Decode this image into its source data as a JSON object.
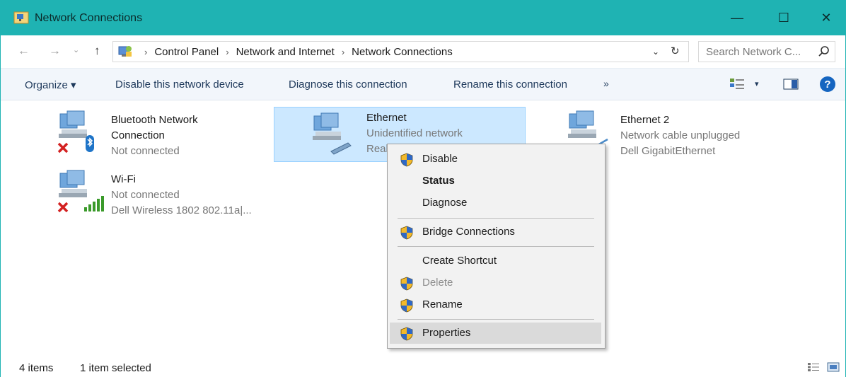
{
  "window": {
    "title": "Network Connections",
    "accent": "#1fb3b3"
  },
  "titlebar": {
    "minimize": "—",
    "maximize": "☐",
    "close": "✕"
  },
  "nav": {
    "back": "←",
    "forward": "→",
    "recent": "⌄",
    "up": "↑"
  },
  "address": {
    "crumbs": [
      "Control Panel",
      "Network and Internet",
      "Network Connections"
    ],
    "separator": "›",
    "dropdown": "⌄",
    "refresh": "↻"
  },
  "search": {
    "placeholder": "Search Network C..."
  },
  "toolbar": {
    "organize": "Organize ▾",
    "disable": "Disable this network device",
    "diagnose": "Diagnose this connection",
    "rename": "Rename this connection",
    "more": "»",
    "view_drop": "▾",
    "help": "?"
  },
  "connections": [
    {
      "name_line1": "Bluetooth Network",
      "name_line2": "Connection",
      "status": "Not connected",
      "badge": "bluetooth",
      "disconnected": true
    },
    {
      "name_line1": "Ethernet",
      "status": "Unidentified network",
      "device": "Real",
      "selected": true
    },
    {
      "name_line1": "Ethernet 2",
      "status": "Network cable unplugged",
      "device": "Dell GigabitEthernet"
    },
    {
      "name_line1": "Wi-Fi",
      "status": "Not connected",
      "device": "Dell Wireless 1802 802.11a|...",
      "badge": "wifi",
      "disconnected": true
    }
  ],
  "context_menu": {
    "items": [
      {
        "label": "Disable",
        "shield": true
      },
      {
        "label": "Status",
        "bold": true
      },
      {
        "label": "Diagnose"
      },
      {
        "label": "Bridge Connections",
        "shield": true
      },
      {
        "label": "Create Shortcut"
      },
      {
        "label": "Delete",
        "shield": true,
        "disabled": true
      },
      {
        "label": "Rename",
        "shield": true
      },
      {
        "label": "Properties",
        "shield": true,
        "highlighted": true
      }
    ]
  },
  "status": {
    "items": "4 items",
    "selected": "1 item selected"
  }
}
